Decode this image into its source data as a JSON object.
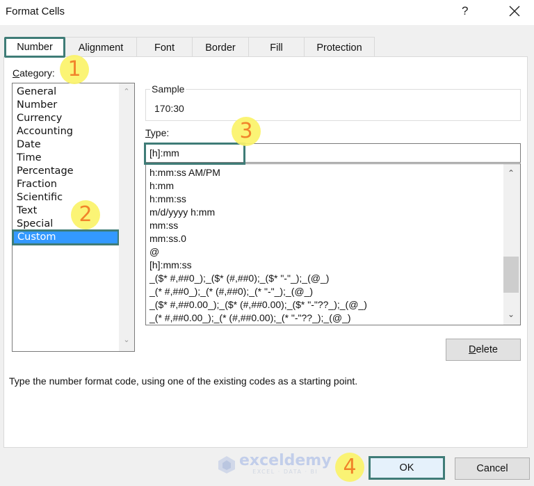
{
  "window": {
    "title": "Format Cells",
    "help_label": "?",
    "close_icon": "close-icon"
  },
  "tabs": [
    {
      "label": "Number",
      "active": true
    },
    {
      "label": "Alignment",
      "active": false
    },
    {
      "label": "Font",
      "active": false
    },
    {
      "label": "Border",
      "active": false
    },
    {
      "label": "Fill",
      "active": false
    },
    {
      "label": "Protection",
      "active": false
    }
  ],
  "category": {
    "label_accel": "C",
    "label_rest": "ategory:",
    "items": [
      "General",
      "Number",
      "Currency",
      "Accounting",
      "Date",
      "Time",
      "Percentage",
      "Fraction",
      "Scientific",
      "Text",
      "Special",
      "Custom"
    ],
    "selected": "Custom"
  },
  "sample": {
    "label": "Sample",
    "value": "170:30"
  },
  "type": {
    "label_accel": "T",
    "label_rest": "ype:",
    "value": "[h]:mm",
    "list": [
      "h:mm:ss AM/PM",
      "h:mm",
      "h:mm:ss",
      "m/d/yyyy h:mm",
      "mm:ss",
      "mm:ss.0",
      "@",
      "[h]:mm:ss",
      "_($* #,##0_);_($* (#,##0);_($* \"-\"_);_(@_)",
      "_(* #,##0_);_(* (#,##0);_(* \"-\"_);_(@_)",
      "_($* #,##0.00_);_($* (#,##0.00);_($* \"-\"??_);_(@_)",
      "_(* #,##0.00_);_(* (#,##0.00);_(* \"-\"??_);_(@_)"
    ]
  },
  "buttons": {
    "delete_accel": "D",
    "delete_rest": "elete",
    "ok": "OK",
    "cancel": "Cancel"
  },
  "hint": "Type the number format code, using one of the existing codes as a starting point.",
  "annotations": {
    "step1": "1",
    "step2": "2",
    "step3": "3",
    "step4": "4"
  },
  "watermark": {
    "name": "exceldemy",
    "tagline": "EXCEL · DATA · BI"
  },
  "colors": {
    "highlight_border": "#3f7c77",
    "selection": "#3399ff",
    "badge_fill": "#fbf46a",
    "badge_text": "#f07a1a"
  }
}
